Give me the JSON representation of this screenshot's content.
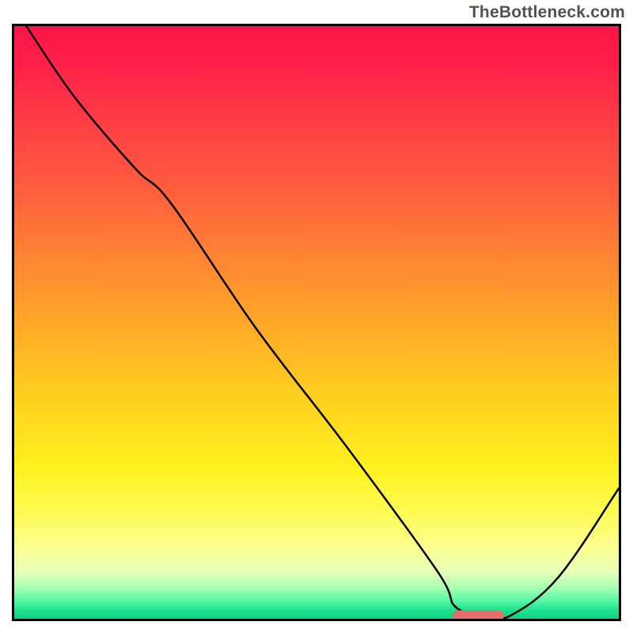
{
  "watermark": "TheBottleneck.com",
  "chart_data": {
    "type": "line",
    "title": "",
    "xlabel": "",
    "ylabel": "",
    "x_range": [
      0,
      100
    ],
    "y_range": [
      0,
      100
    ],
    "grid": false,
    "legend": false,
    "series": [
      {
        "name": "curve",
        "x": [
          2,
          10,
          20,
          26,
          40,
          55,
          70,
          73,
          78,
          82,
          90,
          100
        ],
        "y": [
          100,
          88,
          76,
          70,
          49,
          29,
          8,
          2,
          0.5,
          0.5,
          7,
          22
        ]
      }
    ],
    "marker": {
      "name": "optimal-range",
      "x_start": 72.5,
      "x_end": 81,
      "y": 0.5,
      "color": "#e26f6b"
    },
    "background_gradient": {
      "stops": [
        {
          "pos": 0,
          "color": "#ff1548"
        },
        {
          "pos": 0.5,
          "color": "#ffd41e"
        },
        {
          "pos": 0.88,
          "color": "#fcff91"
        },
        {
          "pos": 1.0,
          "color": "#0fd283"
        }
      ]
    }
  }
}
